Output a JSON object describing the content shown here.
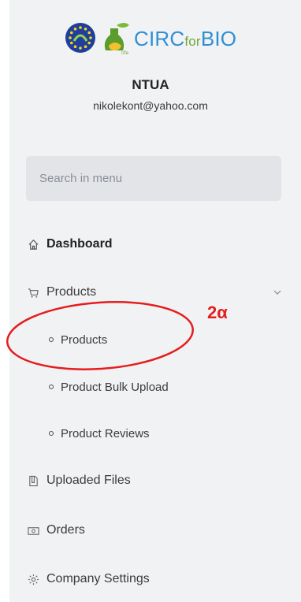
{
  "logo": {
    "text_main": "CIRC",
    "text_small": "for",
    "text_end": "BIO"
  },
  "org": {
    "name": "NTUA",
    "email": "nikolekont@yahoo.com"
  },
  "search": {
    "placeholder": "Search in menu"
  },
  "menu": {
    "dashboard": {
      "label": "Dashboard",
      "icon": "home-icon"
    },
    "products": {
      "label": "Products",
      "icon": "cart-icon",
      "expanded": true
    },
    "products_sub": [
      {
        "label": "Products"
      },
      {
        "label": "Product Bulk Upload"
      },
      {
        "label": "Product Reviews"
      }
    ],
    "uploaded_files": {
      "label": "Uploaded Files",
      "icon": "folder-icon"
    },
    "orders": {
      "label": "Orders",
      "icon": "money-icon"
    },
    "company_settings": {
      "label": "Company Settings",
      "icon": "gear-icon"
    }
  },
  "annotation": {
    "label": "2α",
    "color": "#e51d1d"
  }
}
